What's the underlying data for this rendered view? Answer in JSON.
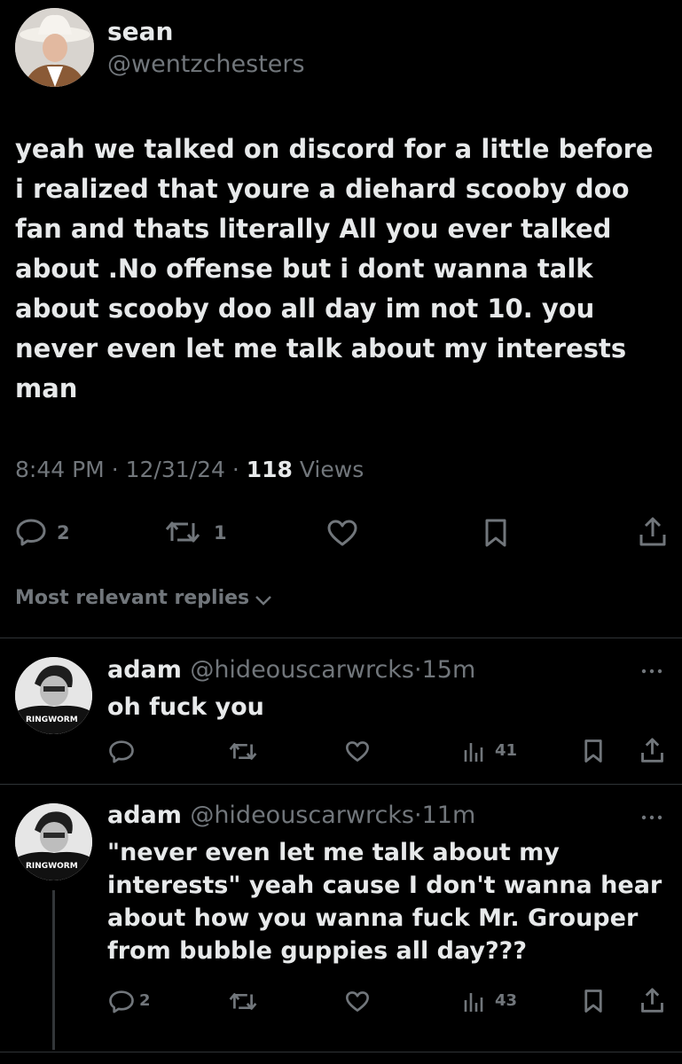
{
  "tweet": {
    "display_name": "sean",
    "handle": "@wentzchesters",
    "text": "yeah we talked on discord for a little before\ni realized that youre a diehard scooby doo\nfan and thats literally All you ever talked\nabout .No offense but i dont wanna talk\nabout scooby doo all day im not 10. you\nnever even let me talk about my interests\nman",
    "time": "8:44 PM",
    "date": "12/31/24",
    "views_count": "118",
    "views_label": "Views",
    "separator": "·",
    "reply_count": "2",
    "retweet_count": "1"
  },
  "sort": {
    "label": "Most relevant replies"
  },
  "replies": [
    {
      "display_name": "adam",
      "handle": "@hideouscarwrcks",
      "separator": "·",
      "age": "15m",
      "text": "oh fuck you",
      "views": "41",
      "avatar_shirt_text": "RINGWORM"
    },
    {
      "display_name": "adam",
      "handle": "@hideouscarwrcks",
      "separator": "·",
      "age": "11m",
      "text": "\"never even let me talk about my\ninterests\" yeah cause I don't wanna hear\nabout how you wanna fuck Mr. Grouper\nfrom bubble guppies all day???",
      "reply_count": "2",
      "views": "43",
      "avatar_shirt_text": "RINGWORM"
    }
  ],
  "icons": {
    "reply": "reply-icon",
    "retweet": "retweet-icon",
    "like": "heart-icon",
    "bookmark": "bookmark-icon",
    "share": "share-icon",
    "views": "views-chart-icon",
    "more": "more-icon",
    "chevron": "chevron-down-icon"
  },
  "colors": {
    "background": "#000000",
    "text": "#e7e9ea",
    "muted": "#71767b",
    "divider": "#2f3336"
  }
}
